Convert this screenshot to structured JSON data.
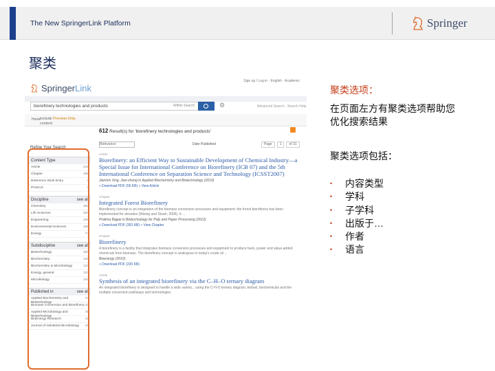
{
  "header": {
    "title": "The New SpringerLink Platform",
    "logo_text": "Springer",
    "colors": {
      "accent": "#1c3f8c",
      "band": "#f0f0f0"
    }
  },
  "slide_title": "聚类",
  "screenshot": {
    "logo_text_a": "Springer",
    "logo_text_b": "Link",
    "top_links": "Sign up / Log in  ·  English  ·  Academic",
    "search_value": "biorefinery technologies and products",
    "search_within": "Within Search",
    "advanced_link": "Advanced Search · Search Help",
    "home_link": "Home",
    "include_text_a": "Include",
    "include_text_b": "Preview-Only",
    "include_text_c": "content",
    "results_count": "612",
    "results_header": "Result(s) for 'biorefinery technologies and products'",
    "sort_value": "Relevance",
    "date_published": "Date Published",
    "page_label": "Page",
    "page_value": "1",
    "page_of": "of 31",
    "refine_title": "Refine Your Search",
    "facets": [
      {
        "title": "Content Type",
        "more": "",
        "items": [
          {
            "label": "Article",
            "count": "315"
          },
          {
            "label": "Chapter",
            "count": "289"
          },
          {
            "label": "Reference Work Entry",
            "count": "4"
          },
          {
            "label": "Protocol",
            "count": "4"
          }
        ]
      },
      {
        "title": "Discipline",
        "more": "see all",
        "items": [
          {
            "label": "Chemistry",
            "count": "392"
          },
          {
            "label": "Life Sciences",
            "count": "283"
          },
          {
            "label": "Engineering",
            "count": "258"
          },
          {
            "label": "Environmental Sciences",
            "count": "186"
          },
          {
            "label": "Energy",
            "count": "74"
          }
        ]
      },
      {
        "title": "Subdiscipline",
        "more": "see all",
        "items": [
          {
            "label": "Biotechnology",
            "count": "302"
          },
          {
            "label": "Biochemistry",
            "count": "126"
          },
          {
            "label": "Biochemistry & Microbiology",
            "count": "123"
          },
          {
            "label": "Energy, general",
            "count": "120"
          },
          {
            "label": "Microbiology",
            "count": "100"
          }
        ]
      },
      {
        "title": "Published in",
        "more": "see all",
        "items": [
          {
            "label": "Applied Biochemistry and Biotechnology",
            "count": "44"
          },
          {
            "label": "Biomass Conversion and Biorefinery",
            "count": "42"
          },
          {
            "label": "Applied Microbiology and Biotechnology",
            "count": "41"
          },
          {
            "label": "BioEnergy Research",
            "count": "16"
          },
          {
            "label": "Journal of Industrial Microbiology",
            "count": "15"
          }
        ]
      }
    ],
    "results": [
      {
        "type": "Article",
        "title": "Biorefinery: an Efficient Way to Sustainable Development of Chemical Industry—a Special Issue for International Conference on Biorefinery (ICB 07) and the 5th International Conference on Separation Science and Technology (ICSST2007)",
        "snippet": "",
        "source": "Jianmin Xing, Jian-zhong in Applied Biochemistry and Biotechnology (2010)",
        "download": "» Download PDF (55 KB) » View Article"
      },
      {
        "type": "Chapter",
        "title": "Integrated Forest Biorefinery",
        "snippet": "Biorefinery concept is an integration of the biomass conversion processes and equipment; the forest biorefinery has been implemented for decades (Wising and Stuart, 2006). It ...",
        "source": "Pratima Bajpai in Biotechnology for Pulp and Paper Processing (2012)",
        "download": "» Download PDF (353 KB) » View Chapter"
      },
      {
        "type": "Chapter",
        "title": "Biorefinery",
        "snippet": "A biorefinery is a facility that integrates biomass conversion processes and equipment to produce fuels, power and value-added chemicals from biomass. The biorefinery concept is analogous to today's crude oil ...",
        "source": "Bioenergy (2010)",
        "download": "» Download PDF (230 KB)"
      },
      {
        "type": "Article",
        "title": "Synthesis of an integrated biorefinery via the C–H–O ternary diagram",
        "snippet": "An integrated biorefinery is designed to handle a wide variety... using the C-H-O ternary diagram, biofuel, biochemicals and the multiple conversion pathways and technologies",
        "source": "",
        "download": ""
      }
    ]
  },
  "annotation": {
    "title": "聚类选项：",
    "body_line1": "在页面左方有聚类选项帮助您",
    "body_line2": "优化搜索结果",
    "body2": "聚类选项包括：",
    "bullet_char": "•",
    "bullets": [
      "内容类型",
      "学科",
      "子学科",
      "出版于…",
      "作者",
      "语言"
    ],
    "colors": {
      "highlight": "#c43d18",
      "box": "#e06b2c"
    }
  }
}
